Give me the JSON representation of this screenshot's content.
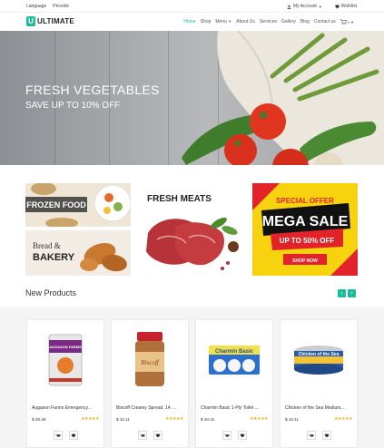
{
  "topbar": {
    "language": "Language",
    "pricelist": "Pricelist",
    "my_account": "My Account",
    "wishlist": "Wishlist"
  },
  "header": {
    "logo_mark": "U",
    "logo_text": "ULTIMATE",
    "nav": {
      "home": "Home",
      "shop": "Shop",
      "menu": "Menu",
      "about": "About Us",
      "services": "Services",
      "gallery": "Gallery",
      "blog": "Blog",
      "contact": "Contact us",
      "cart_count": "0"
    }
  },
  "hero": {
    "title": "FRESH VEGETABLES",
    "subtitle": "SAVE UP TO 10% OFF"
  },
  "banners": {
    "frozen": "FROZEN FOOD",
    "bread_line1": "Bread &",
    "bread_line2": "BAKERY",
    "meats": "FRESH MEATS",
    "sale_special": "SPECIAL OFFER",
    "sale_mega": "MEGA SALE",
    "sale_upto": "UP TO 50% OFF",
    "sale_shop": "SHOP NOW"
  },
  "new_products": {
    "title": "New Products",
    "items": [
      {
        "name": "Augason Farms Emergency...",
        "price": "$ 29.49",
        "label": "AUGASON FARMS",
        "color": "#e8e8e8"
      },
      {
        "name": "Biscoff Creamy Spread, 14 ...",
        "price": "$ 10.11",
        "label": "Biscoff",
        "color": "#b0703a"
      },
      {
        "name": "Charmin Basic 1-Ply Toilet ...",
        "price": "$ 40.31",
        "label": "Charmin Basic",
        "color": "#2c6fcf"
      },
      {
        "name": "Chicken of the Sea Medium...",
        "price": "$ 10.11",
        "label": "Chicken of the Sea",
        "color": "#2a5ca8"
      }
    ],
    "stars": "★★★★★"
  },
  "colors": {
    "accent": "#1abc9c",
    "sale_yellow": "#f6d20f",
    "sale_red": "#e3232a",
    "star": "#f2b01e"
  }
}
